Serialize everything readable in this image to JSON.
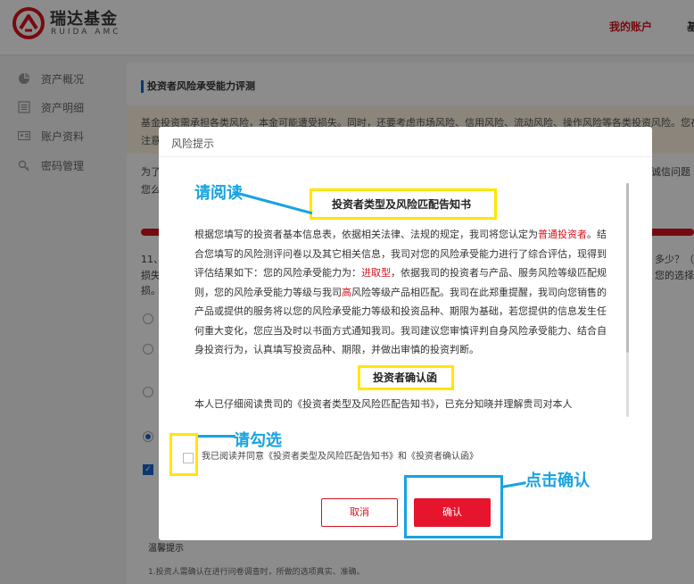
{
  "header": {
    "brand_cn": "瑞达基金",
    "brand_en": "RUIDA AMC",
    "nav_account": "我的账户",
    "nav_more": "基"
  },
  "sidebar": {
    "items": [
      {
        "label": "资产概况",
        "icon": "pie-chart-icon"
      },
      {
        "label": "资产明细",
        "icon": "list-icon"
      },
      {
        "label": "账户资料",
        "icon": "id-card-icon"
      },
      {
        "label": "密码管理",
        "icon": "lock-icon"
      }
    ]
  },
  "main": {
    "title": "投资者风险承受能力评测",
    "notice": "基金投资需承担各类风险，本金可能遭受损失。同时，还要考虑市场风险、信用风险、流动风险、操作风险等各类投资风险。您在",
    "notice_line2": "注意",
    "bg_line1_left": "为了",
    "bg_line1_right": "诚信问题",
    "bg_line2_left": "您么",
    "question_left": "11、",
    "question_right": "多少？（",
    "question_line2_left": "损失",
    "question_line2_right": "您的选择",
    "question_line3_left": "损。",
    "tips_title": "温馨提示",
    "tips_line": "1.投资人需确认在进行问卷调查时，所做的选项真实、准确。"
  },
  "modal": {
    "title": "风险提示",
    "doc1_title": "投资者类型及风险匹配告知书",
    "doc1_p_a": "根据您填写的投资者基本信息表，依据相关法律、法规的规定，我司将您认定为",
    "doc1_p_hl1": "普通投资者",
    "doc1_p_b": "。结合您填写的风险测评问卷以及其它相关信息，我司对您的风险承受能力进行了综合评估，现得到评估结果如下：您的风险承受能力为：",
    "doc1_p_hl2": "进取型",
    "doc1_p_c": "，依据我司的投资者与产品、服务风险等级匹配规则，您的风险承受能力等级与我司",
    "doc1_p_hl3": "高",
    "doc1_p_d": "风险等级产品相匹配。我司在此郑重提醒，我司向您销售的产品或提供的服务将以您的风险承受能力等级和投资品种、期限为基础，若您提供的信息发生任何重大变化，您应当及时以书面方式通知我司。我司建议您审慎评判自身风险承受能力、结合自身投资行为，认真填写投资品种、期限，并做出审慎的投资判断。",
    "doc2_title": "投资者确认函",
    "doc2_p": "本人已仔细阅读贵司的《投资者类型及风险匹配告知书》，已充分知晓并理解贵司对本人",
    "agree_text": "我已阅读并同意《投资者类型及风险匹配告知书》和《投资者确认函》",
    "cancel_label": "取消",
    "ok_label": "确认"
  },
  "annotations": {
    "read": "请阅读",
    "check": "请勾选",
    "click": "点击确认"
  },
  "colors": {
    "brand_red": "#d6141e",
    "annotation_blue": "#18a3e0",
    "annotation_yellow": "#ffe600",
    "button_red": "#e6142d"
  }
}
